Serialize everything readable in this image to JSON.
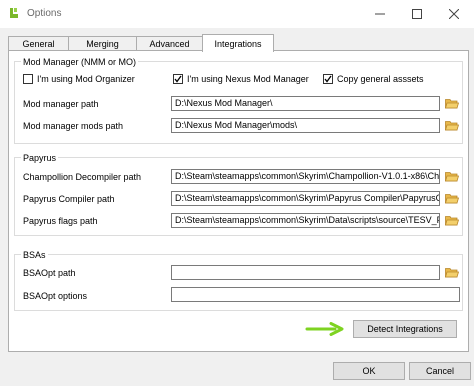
{
  "window": {
    "title": "Options"
  },
  "tabs": [
    {
      "label": "General"
    },
    {
      "label": "Merging"
    },
    {
      "label": "Advanced"
    },
    {
      "label": "Integrations"
    }
  ],
  "mod_manager": {
    "group_title": "Mod Manager (NMM or MO)",
    "checkbox_mo": {
      "label": "I'm using Mod Organizer",
      "checked": false
    },
    "checkbox_nmm": {
      "label": "I'm using Nexus Mod Manager",
      "checked": true
    },
    "checkbox_assets": {
      "label": "Copy general asssets",
      "checked": true
    },
    "path_label": "Mod manager path",
    "path_value": "D:\\Nexus Mod Manager\\",
    "mods_path_label": "Mod manager mods path",
    "mods_path_value": "D:\\Nexus Mod Manager\\mods\\"
  },
  "papyrus": {
    "group_title": "Papyrus",
    "decompiler_label": "Champollion Decompiler path",
    "decompiler_value": "D:\\Steam\\steamapps\\common\\Skyrim\\Champollion-V1.0.1-x86\\Ch",
    "compiler_label": "Papyrus Compiler path",
    "compiler_value": "D:\\Steam\\steamapps\\common\\Skyrim\\Papyrus Compiler\\PapyrusC",
    "flags_label": "Papyrus flags path",
    "flags_value": "D:\\Steam\\steamapps\\common\\Skyrim\\Data\\scripts\\source\\TESV_F"
  },
  "bsas": {
    "group_title": "BSAs",
    "path_label": "BSAOpt path",
    "path_value": "",
    "options_label": "BSAOpt options",
    "options_value": ""
  },
  "buttons": {
    "detect": "Detect Integrations",
    "ok": "OK",
    "cancel": "Cancel"
  },
  "colors": {
    "arrow": "#7ed321",
    "folder": "#e8b84a"
  }
}
